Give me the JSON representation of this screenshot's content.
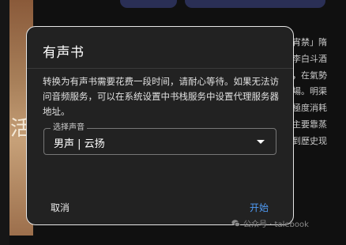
{
  "background": {
    "cover_glyph": "活",
    "text_lines": [
      "宵禁」隋",
      "李白斗酒",
      "，在氣勢",
      "場。明渠",
      "極度消耗",
      "主要靠蒸",
      "到歷史现"
    ]
  },
  "dialog": {
    "title": "有声书",
    "message": "转换为有声书需要花费一段时间，请耐心等待。如果无法访问音频服务，可以在系统设置中书栈服务中设置代理服务器地址。",
    "select": {
      "label": "选择声音",
      "value": "男声 | 云扬"
    },
    "cancel_label": "取消",
    "start_label": "开始"
  },
  "watermark": {
    "text": "公众号 · talebook"
  },
  "colors": {
    "dialog_bg": "#222222",
    "accent": "#4f9bf5",
    "page_bg": "#101010"
  }
}
